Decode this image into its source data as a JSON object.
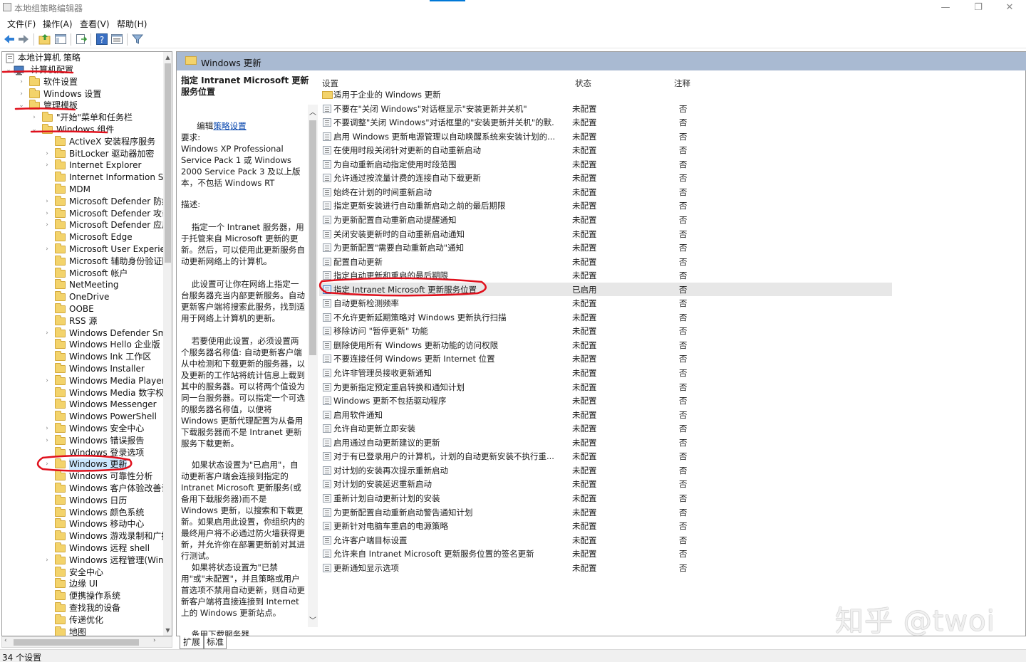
{
  "window": {
    "title": "本地组策略编辑器",
    "minimize_glyph": "—",
    "restore_glyph": "❐",
    "close_glyph": "✕"
  },
  "menu": [
    "文件(F)",
    "操作(A)",
    "查看(V)",
    "帮助(H)"
  ],
  "toolbar_icons": [
    "back-arrow-icon",
    "forward-arrow-icon",
    "up-folder-icon",
    "show-hide-tree-icon",
    "export-list-icon",
    "help-icon",
    "properties-icon",
    "filter-icon"
  ],
  "tree": {
    "root": "本地计算机 策略",
    "items": [
      {
        "label": "计算机配置",
        "level": 1,
        "expanded": true,
        "type": "computer"
      },
      {
        "label": "软件设置",
        "level": 2,
        "expandable": true
      },
      {
        "label": "Windows 设置",
        "level": 2,
        "expandable": true
      },
      {
        "label": "管理模板",
        "level": 2,
        "expanded": true
      },
      {
        "label": "\"开始\"菜单和任务栏",
        "level": 3,
        "expandable": true
      },
      {
        "label": "Windows 组件",
        "level": 3,
        "expanded": true
      },
      {
        "label": "ActiveX 安装程序服务",
        "level": 4
      },
      {
        "label": "BitLocker 驱动器加密",
        "level": 4,
        "expandable": true
      },
      {
        "label": "Internet Explorer",
        "level": 4,
        "expandable": true
      },
      {
        "label": "Internet Information Servic",
        "level": 4
      },
      {
        "label": "MDM",
        "level": 4
      },
      {
        "label": "Microsoft Defender 防病毒",
        "level": 4,
        "expandable": true
      },
      {
        "label": "Microsoft Defender 攻击防",
        "level": 4,
        "expandable": true
      },
      {
        "label": "Microsoft Defender 应用程",
        "level": 4,
        "expandable": true
      },
      {
        "label": "Microsoft Edge",
        "level": 4
      },
      {
        "label": "Microsoft User Experience",
        "level": 4,
        "expandable": true
      },
      {
        "label": "Microsoft 辅助身份验证因",
        "level": 4
      },
      {
        "label": "Microsoft 帐户",
        "level": 4
      },
      {
        "label": "NetMeeting",
        "level": 4
      },
      {
        "label": "OneDrive",
        "level": 4
      },
      {
        "label": "OOBE",
        "level": 4
      },
      {
        "label": "RSS 源",
        "level": 4
      },
      {
        "label": "Windows Defender Smart",
        "level": 4,
        "expandable": true
      },
      {
        "label": "Windows Hello 企业版",
        "level": 4
      },
      {
        "label": "Windows Ink 工作区",
        "level": 4
      },
      {
        "label": "Windows Installer",
        "level": 4
      },
      {
        "label": "Windows Media Player",
        "level": 4,
        "expandable": true
      },
      {
        "label": "Windows Media 数字权限",
        "level": 4
      },
      {
        "label": "Windows Messenger",
        "level": 4
      },
      {
        "label": "Windows PowerShell",
        "level": 4
      },
      {
        "label": "Windows 安全中心",
        "level": 4,
        "expandable": true
      },
      {
        "label": "Windows 错误报告",
        "level": 4,
        "expandable": true
      },
      {
        "label": "Windows 登录选项",
        "level": 4
      },
      {
        "label": "Windows 更新",
        "level": 4,
        "expandable": true,
        "selected": true
      },
      {
        "label": "Windows 可靠性分析",
        "level": 4
      },
      {
        "label": "Windows 客户体验改善计",
        "level": 4
      },
      {
        "label": "Windows 日历",
        "level": 4
      },
      {
        "label": "Windows 颜色系统",
        "level": 4
      },
      {
        "label": "Windows 移动中心",
        "level": 4
      },
      {
        "label": "Windows 游戏录制和广播",
        "level": 4
      },
      {
        "label": "Windows 远程 shell",
        "level": 4
      },
      {
        "label": "Windows 远程管理(WinRM",
        "level": 4,
        "expandable": true
      },
      {
        "label": "安全中心",
        "level": 4
      },
      {
        "label": "边缘 UI",
        "level": 4
      },
      {
        "label": "便携操作系统",
        "level": 4
      },
      {
        "label": "查找我的设备",
        "level": 4
      },
      {
        "label": "传递优化",
        "level": 4
      },
      {
        "label": "地图",
        "level": 4
      }
    ]
  },
  "pane_title": "Windows 更新",
  "description": {
    "title": "指定 Intranet Microsoft 更新服务位置",
    "edit_prefix": "编辑",
    "edit_link": "策略设置",
    "req_label": "要求:",
    "req_text": "Windows XP Professional Service Pack 1 或 Windows 2000 Service Pack 3 及以上版本，不包括 Windows RT",
    "desc_label": "描述:",
    "p1": "    指定一个 Intranet 服务器，用于托管来自 Microsoft 更新的更新。然后，可以使用此更新服务自动更新网络上的计算机。",
    "p2": "    此设置可让你在网络上指定一台服务器充当内部更新服务。自动更新客户端将搜索此服务，找到适用于网络上计算机的更新。",
    "p3": "    若要使用此设置，必须设置两个服务器名称值: 自动更新客户端从中检测和下载更新的服务器，以及更新的工作站将统计信息上载到其中的服务器。可以将两个值设为同一台服务器。可以指定一个可选的服务器名称值，以便将 Windows 更新代理配置为从备用下载服务器而不是 Intranet 更新服务下载更新。",
    "p4": "    如果状态设置为\"已启用\"，自动更新客户端会连接到指定的 Intranet Microsoft 更新服务(或备用下载服务器)而不是 Windows 更新，以搜索和下载更新。如果启用此设置，你组织内的最终用户将不必通过防火墙获得更新，并允许你在部署更新前对其进行测试。",
    "p5": "    如果将状态设置为\"已禁用\"或\"未配置\"，并且策略或用户首选项不禁用自动更新，则自动更新客户端将直接连接到 Internet 上的 Windows 更新站点。",
    "p6": "    备用下载服务器"
  },
  "list": {
    "col_setting": "设置",
    "col_state": "状态",
    "col_note": "注释",
    "rows": [
      {
        "name": "适用于企业的 Windows 更新",
        "state": "",
        "note": "",
        "folder": true
      },
      {
        "name": "不要在\"关闭 Windows\"对话框显示\"安装更新并关机\"",
        "state": "未配置",
        "note": "否"
      },
      {
        "name": "不要调整\"关闭 Windows\"对话框里的\"安装更新并关机\"的默...",
        "state": "未配置",
        "note": "否"
      },
      {
        "name": "启用 Windows 更新电源管理以自动唤醒系统来安装计划的...",
        "state": "未配置",
        "note": "否"
      },
      {
        "name": "在使用时段关闭针对更新的自动重新启动",
        "state": "未配置",
        "note": "否"
      },
      {
        "name": "为自动重新启动指定使用时段范围",
        "state": "未配置",
        "note": "否"
      },
      {
        "name": "允许通过按流量计费的连接自动下载更新",
        "state": "未配置",
        "note": "否"
      },
      {
        "name": "始终在计划的时间重新启动",
        "state": "未配置",
        "note": "否"
      },
      {
        "name": "指定更新安装进行自动重新启动之前的最后期限",
        "state": "未配置",
        "note": "否"
      },
      {
        "name": "为更新配置自动重新启动提醒通知",
        "state": "未配置",
        "note": "否"
      },
      {
        "name": "关闭安装更新时的自动重新启动通知",
        "state": "未配置",
        "note": "否"
      },
      {
        "name": "为更新配置\"需要自动重新启动\"通知",
        "state": "未配置",
        "note": "否"
      },
      {
        "name": "配置自动更新",
        "state": "未配置",
        "note": "否"
      },
      {
        "name": "指定自动更新和重启的最后期限",
        "state": "未配置",
        "note": "否"
      },
      {
        "name": "指定 Intranet Microsoft 更新服务位置",
        "state": "已启用",
        "note": "否",
        "highlight": true
      },
      {
        "name": "自动更新检测频率",
        "state": "未配置",
        "note": "否"
      },
      {
        "name": "不允许更新延期策略对 Windows 更新执行扫描",
        "state": "未配置",
        "note": "否"
      },
      {
        "name": "移除访问 \"暂停更新\" 功能",
        "state": "未配置",
        "note": "否"
      },
      {
        "name": "删除使用所有 Windows 更新功能的访问权限",
        "state": "未配置",
        "note": "否"
      },
      {
        "name": "不要连接任何 Windows 更新 Internet 位置",
        "state": "未配置",
        "note": "否"
      },
      {
        "name": "允许非管理员接收更新通知",
        "state": "未配置",
        "note": "否"
      },
      {
        "name": "为更新指定预定重启转换和通知计划",
        "state": "未配置",
        "note": "否"
      },
      {
        "name": "Windows 更新不包括驱动程序",
        "state": "未配置",
        "note": "否"
      },
      {
        "name": "启用软件通知",
        "state": "未配置",
        "note": "否"
      },
      {
        "name": "允许自动更新立即安装",
        "state": "未配置",
        "note": "否"
      },
      {
        "name": "启用通过自动更新建议的更新",
        "state": "未配置",
        "note": "否"
      },
      {
        "name": "对于有已登录用户的计算机，计划的自动更新安装不执行重...",
        "state": "未配置",
        "note": "否"
      },
      {
        "name": "对计划的安装再次提示重新启动",
        "state": "未配置",
        "note": "否"
      },
      {
        "name": "对计划的安装延迟重新启动",
        "state": "未配置",
        "note": "否"
      },
      {
        "name": "重新计划自动更新计划的安装",
        "state": "未配置",
        "note": "否"
      },
      {
        "name": "为更新配置自动重新启动警告通知计划",
        "state": "未配置",
        "note": "否"
      },
      {
        "name": "更新针对电脑车重启的电源策略",
        "state": "未配置",
        "note": "否"
      },
      {
        "name": "允许客户端目标设置",
        "state": "未配置",
        "note": "否"
      },
      {
        "name": "允许来自 Intranet Microsoft 更新服务位置的签名更新",
        "state": "未配置",
        "note": "否"
      },
      {
        "name": "更新通知显示选项",
        "state": "未配置",
        "note": "否"
      }
    ]
  },
  "tabs": [
    "扩展",
    "标准"
  ],
  "status": "34 个设置",
  "watermark": "知乎 @twoi",
  "colors": {
    "pane_header": "#a9bad2",
    "annotation_red": "#e0101c",
    "link": "#0645ad",
    "selection": "#cce8ff"
  }
}
